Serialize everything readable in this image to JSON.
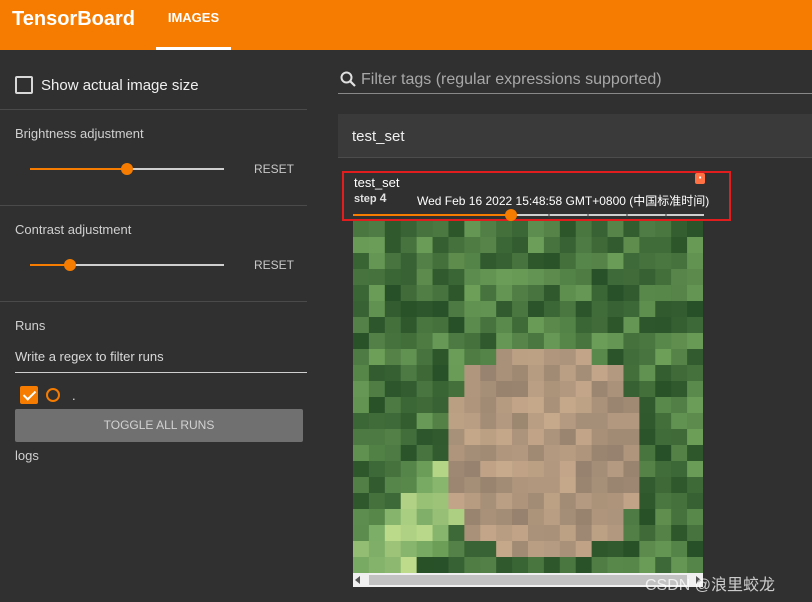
{
  "header": {
    "app_title": "TensorBoard",
    "tabs": [
      {
        "label": "IMAGES"
      }
    ],
    "accent_color": "#f57c00"
  },
  "sidebar": {
    "show_actual_size_label": "Show actual image size",
    "brightness": {
      "title": "Brightness adjustment",
      "reset_label": "RESET",
      "value": 0.5
    },
    "contrast": {
      "title": "Contrast adjustment",
      "reset_label": "RESET",
      "value": 0.2
    },
    "runs": {
      "title": "Runs",
      "filter_placeholder": "Write a regex to filter runs",
      "items": [
        {
          "name": "."
        }
      ],
      "toggle_all_label": "TOGGLE ALL RUNS",
      "logs_label": "logs"
    }
  },
  "main": {
    "search_placeholder": "Filter tags (regular expressions supported)",
    "card_title": "test_set",
    "image": {
      "tag": "test_set",
      "step_label": "step",
      "step_value": "4",
      "timestamp": "Wed Feb 16 2022 15:48:58 GMT+0800 (中国标准时间)",
      "step_slider_value": 0.45,
      "pin_icon": "pin-icon"
    }
  },
  "watermark": "CSDN @浪里蛟龙"
}
